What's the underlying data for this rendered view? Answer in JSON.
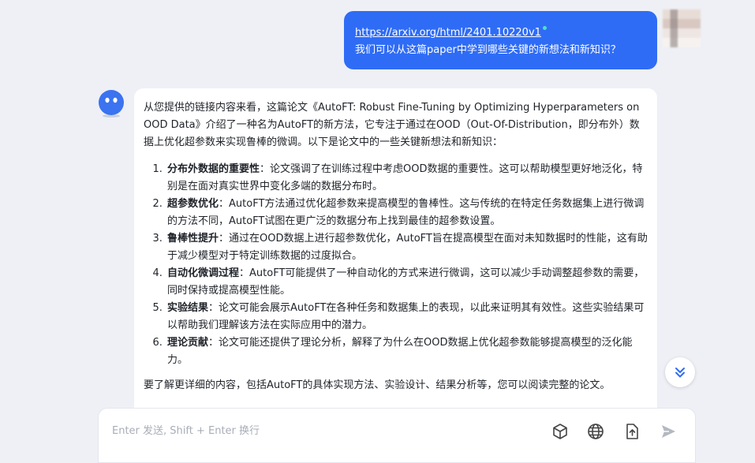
{
  "user_message": {
    "link": "https://arxiv.org/html/2401.10220v1",
    "question": "我们可以从这篇paper中学到哪些关键的新想法和新知识？"
  },
  "assistant_message": {
    "intro": "从您提供的链接内容来看，这篇论文《AutoFT: Robust Fine-Tuning by Optimizing Hyperparameters on OOD Data》介绍了一种名为AutoFT的新方法，它专注于通过在OOD（Out-Of-Distribution，即分布外）数据上优化超参数来实现鲁棒的微调。以下是论文中的一些关键新想法和新知识：",
    "points": [
      {
        "title": "分布外数据的重要性",
        "text": "：论文强调了在训练过程中考虑OOD数据的重要性。这可以帮助模型更好地泛化，特别是在面对真实世界中变化多端的数据分布时。"
      },
      {
        "title": "超参数优化",
        "text": "：AutoFT方法通过优化超参数来提高模型的鲁棒性。这与传统的在特定任务数据集上进行微调的方法不同，AutoFT试图在更广泛的数据分布上找到最佳的超参数设置。"
      },
      {
        "title": "鲁棒性提升",
        "text": "：通过在OOD数据上进行超参数优化，AutoFT旨在提高模型在面对未知数据时的性能，这有助于减少模型对于特定训练数据的过度拟合。"
      },
      {
        "title": "自动化微调过程",
        "text": "：AutoFT可能提供了一种自动化的方式来进行微调，这可以减少手动调整超参数的需要，同时保持或提高模型性能。"
      },
      {
        "title": "实验结果",
        "text": "：论文可能会展示AutoFT在各种任务和数据集上的表现，以此来证明其有效性。这些实验结果可以帮助我们理解该方法在实际应用中的潜力。"
      },
      {
        "title": "理论贡献",
        "text": "：论文可能还提供了理论分析，解释了为什么在OOD数据上优化超参数能够提高模型的泛化能力。"
      }
    ],
    "more": "要了解更详细的内容，包括AutoFT的具体实现方法、实验设计、结果分析等，您可以阅读完整的论文。"
  },
  "composer": {
    "placeholder": "Enter 发送, Shift + Enter 换行",
    "value": ""
  },
  "icons": {
    "scroll_down": "double-chevron-down-icon",
    "cube": "cube-icon",
    "web": "globe-icon",
    "upload": "file-upload-icon",
    "send": "send-icon"
  },
  "colors": {
    "background": "#eef0f6",
    "user_bubble": "#2f6cf6",
    "accent": "#2f6cf6",
    "bot_avatar": "#3b73f0"
  }
}
